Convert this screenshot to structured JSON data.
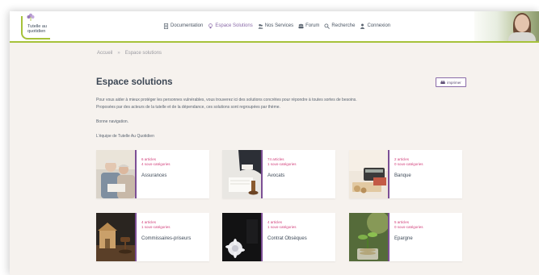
{
  "header": {
    "logo_text": "Tutelle au quotidien",
    "nav": [
      {
        "label": "Documentation",
        "icon": "document-icon"
      },
      {
        "label": "Espace Solutions",
        "icon": "lightbulb-icon",
        "active": true
      },
      {
        "label": "Nos Services",
        "icon": "people-icon"
      },
      {
        "label": "Forum",
        "icon": "group-icon"
      },
      {
        "label": "Recherche",
        "icon": "search-icon"
      },
      {
        "label": "Connexion",
        "icon": "user-icon"
      }
    ]
  },
  "breadcrumb": {
    "home": "Accueil",
    "separator": "»",
    "current": "Espace solutions"
  },
  "page": {
    "title": "Espace solutions",
    "print_label": "imprimer",
    "intro_line1": "Pour vous aider à mieux protéger les personnes vulnérables, vous trouverez ici des solutions concrètes pour répondre à toutes sortes de besoins.",
    "intro_line2": "Proposées par des acteurs de la tutelle et de la dépendance, ces solutions sont regroupées par thème.",
    "intro_line3": "Bonne navigation.",
    "signature": "L'équipe de Tutelle Au Quotidien"
  },
  "cards": [
    {
      "name": "Assurances",
      "articles": "6 articles",
      "subcategories": "4 sous-catégories"
    },
    {
      "name": "Avocats",
      "articles": "74 articles",
      "subcategories": "1 sous-catégories"
    },
    {
      "name": "Banque",
      "articles": "2 articles",
      "subcategories": "0 sous-catégories"
    },
    {
      "name": "Commissaires-priseurs",
      "articles": "4 articles",
      "subcategories": "1 sous-catégories"
    },
    {
      "name": "Contrat Obsèques",
      "articles": "4 articles",
      "subcategories": "1 sous-catégories"
    },
    {
      "name": "Epargne",
      "articles": "5 articles",
      "subcategories": "0 sous-catégories"
    }
  ],
  "colors": {
    "accent_green": "#a6c23a",
    "accent_purple": "#7c4f95",
    "meta_pink": "#d13e7a",
    "background": "#f6f2ee"
  }
}
